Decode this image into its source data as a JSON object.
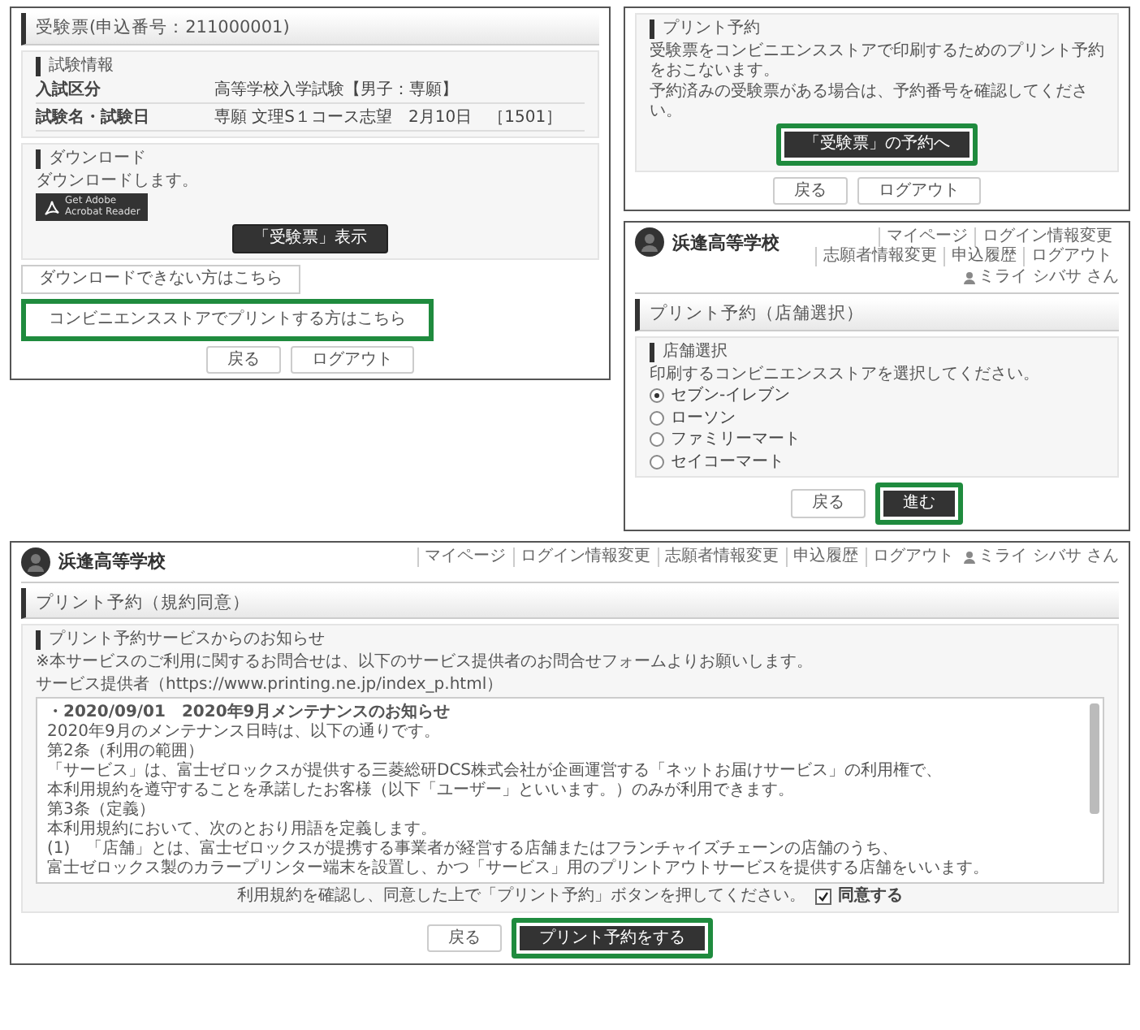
{
  "ticket_screen": {
    "title": "受験票(申込番号：211000001)",
    "exam_info": {
      "heading": "試験情報",
      "rows": [
        {
          "label": "入試区分",
          "value": "高等学校入学試験【男子：専願】"
        },
        {
          "label": "試験名・試験日",
          "value": "専願 文理S１コース志望　2月10日　［1501］"
        }
      ]
    },
    "download": {
      "heading": "ダウンロード",
      "text": "ダウンロードします。",
      "badge": [
        "Get Adobe",
        "Acrobat Reader"
      ],
      "show_button": "「受験票」表示"
    },
    "links": [
      {
        "label": "ダウンロードできない方はこちら",
        "highlighted": false
      },
      {
        "label": "コンビニエンスストアでプリントする方はこちら",
        "highlighted": true
      }
    ],
    "buttons": [
      {
        "label": "戻る",
        "kind": "plain",
        "highlighted": false
      },
      {
        "label": "ログアウト",
        "kind": "plain",
        "highlighted": false
      }
    ]
  },
  "reserve_screen": {
    "heading": "プリント予約",
    "paragraphs": [
      "受験票をコンビニエンスストアで印刷するためのプリント予約をおこないます。",
      "予約済みの受験票がある場合は、予約番号を確認してください。"
    ],
    "action": {
      "label": "「受験票」の予約へ",
      "kind": "dark",
      "highlighted": true
    },
    "buttons": [
      {
        "label": "戻る",
        "kind": "plain",
        "highlighted": false
      },
      {
        "label": "ログアウト",
        "kind": "plain",
        "highlighted": false
      }
    ]
  },
  "store_screen": {
    "header": {
      "school": "浜逢高等学校",
      "nav": [
        "マイページ",
        "ログイン情報変更",
        "志願者情報変更",
        "申込履歴",
        "ログアウト"
      ],
      "user": "ミライ シバサ さん"
    },
    "title": "プリント予約（店舗選択）",
    "heading": "店舗選択",
    "prompt": "印刷するコンビニエンスストアを選択してください。",
    "stores": [
      {
        "label": "セブン-イレブン",
        "selected": true
      },
      {
        "label": "ローソン",
        "selected": false
      },
      {
        "label": "ファミリーマート",
        "selected": false
      },
      {
        "label": "セイコーマート",
        "selected": false
      }
    ],
    "buttons": [
      {
        "label": "戻る",
        "kind": "plain",
        "highlighted": false
      },
      {
        "label": "進む",
        "kind": "dark",
        "highlighted": true
      }
    ]
  },
  "terms_screen": {
    "header": {
      "school": "浜逢高等学校",
      "nav": [
        "マイページ",
        "ログイン情報変更",
        "志願者情報変更",
        "申込履歴",
        "ログアウト"
      ],
      "user": "ミライ シバサ さん"
    },
    "title": "プリント予約（規約同意）",
    "heading": "プリント予約サービスからのお知らせ",
    "notice": [
      "※本サービスのご利用に関するお問合せは、以下のサービス提供者のお問合せフォームよりお願いします。",
      "サービス提供者（https://www.printing.ne.jp/index_p.html）"
    ],
    "terms_lines": [
      {
        "text": "・2020/09/01　2020年9月メンテナンスのお知らせ",
        "kind": "bold"
      },
      {
        "text": "2020年9月のメンテナンス日時は、以下の通りです。",
        "kind": "normal"
      },
      {
        "text": "第2条（利用の範囲）",
        "kind": "normal"
      },
      {
        "text": "「サービス」は、富士ゼロックスが提供する三菱総研DCS株式会社が企画運営する「ネットお届けサービス」の利用権で、",
        "kind": "normal"
      },
      {
        "text": "本利用規約を遵守することを承諾したお客様（以下「ユーザー」といいます。）のみが利用できます。",
        "kind": "normal"
      },
      {
        "text": "第3条（定義）",
        "kind": "normal"
      },
      {
        "text": "本利用規約において、次のとおり用語を定義します。",
        "kind": "normal"
      },
      {
        "text": "(1)　「店舗」とは、富士ゼロックスが提携する事業者が経営する店舗またはフランチャイズチェーンの店舗のうち、",
        "kind": "normal"
      },
      {
        "text": "富士ゼロックス製のカラープリンター端末を設置し、かつ「サービス」用のプリントアウトサービスを提供する店舗をいいます。",
        "kind": "normal"
      }
    ],
    "instruction": "利用規約を確認し、同意した上で「プリント予約」ボタンを押してください。",
    "agree": {
      "label": "同意する",
      "checked": true
    },
    "buttons": [
      {
        "label": "戻る",
        "kind": "plain",
        "highlighted": false
      },
      {
        "label": "プリント予約をする",
        "kind": "dark",
        "highlighted": true
      }
    ]
  }
}
